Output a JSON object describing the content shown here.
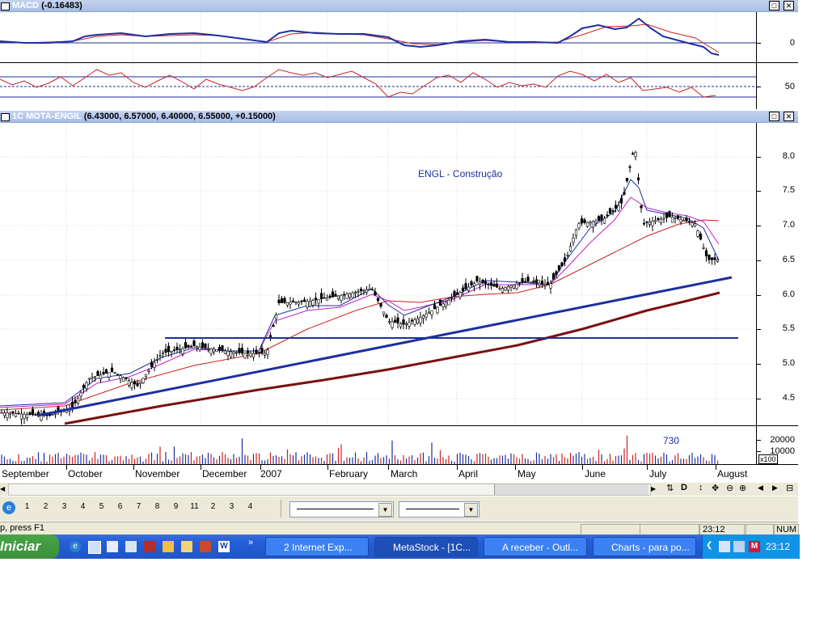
{
  "macd": {
    "title_label": "MACD",
    "title_value": "(-0.16483)",
    "axis_labels": [
      "0"
    ]
  },
  "rsi": {
    "axis_labels": [
      "50"
    ]
  },
  "price": {
    "title_label": "1C MOTA-ENGIL",
    "title_value": "(6.43000, 6.57000, 6.40000, 6.55000, +0.15000)",
    "annotation": "ENGL - Construção",
    "axis_labels": [
      "8.0",
      "7.5",
      "7.0",
      "6.5",
      "6.0",
      "5.5",
      "5.0",
      "4.5"
    ]
  },
  "volume": {
    "annotation": "730",
    "axis_labels": [
      "20000",
      "10000"
    ],
    "axis_scale": "x100"
  },
  "xaxis": {
    "labels": [
      "September",
      "October",
      "November",
      "December",
      "2007",
      "February",
      "March",
      "April",
      "May",
      "June",
      "July",
      "August"
    ]
  },
  "window_buttons": {
    "restore": "□",
    "close": "✕"
  },
  "toolbar": {
    "letter_d": "D",
    "tab_numbers": [
      "1",
      "2",
      "3",
      "4",
      "5",
      "6",
      "7",
      "8",
      "9",
      "11",
      "2",
      "3",
      "4"
    ]
  },
  "statusbar": {
    "help_text": "p, press F1",
    "time": "23:12",
    "num": "NUM"
  },
  "taskbar": {
    "start_label": "Iniciar",
    "tasks": [
      {
        "label": "2 Internet Exp..."
      },
      {
        "label": "MetaStock - [1C..."
      },
      {
        "label": "A receber - Outl..."
      },
      {
        "label": "Charts - para po..."
      }
    ],
    "clock": "23:12",
    "overflow": "»"
  },
  "chart_data": {
    "type": "candlestick",
    "title": "1C MOTA-ENGIL",
    "annotation": "ENGL - Construção",
    "x_labels": [
      "September",
      "October",
      "November",
      "December",
      "2007",
      "February",
      "March",
      "April",
      "May",
      "June",
      "July",
      "August"
    ],
    "ylim": [
      4.2,
      8.4
    ],
    "y_ticks": [
      4.5,
      5.0,
      5.5,
      6.0,
      6.5,
      7.0,
      7.5,
      8.0
    ],
    "last_bar": {
      "open": 6.43,
      "high": 6.57,
      "low": 6.4,
      "close": 6.55,
      "change": 0.15
    },
    "approx_monthly_close": [
      4.35,
      4.8,
      5.15,
      5.2,
      5.9,
      6.1,
      5.6,
      6.2,
      6.2,
      7.1,
      7.1,
      6.5
    ],
    "horizontal_line": 5.36,
    "trendline_blue": [
      [
        0,
        4.28
      ],
      [
        11,
        6.25
      ]
    ],
    "macd_last": -0.16483,
    "volume_annotation": 730
  }
}
